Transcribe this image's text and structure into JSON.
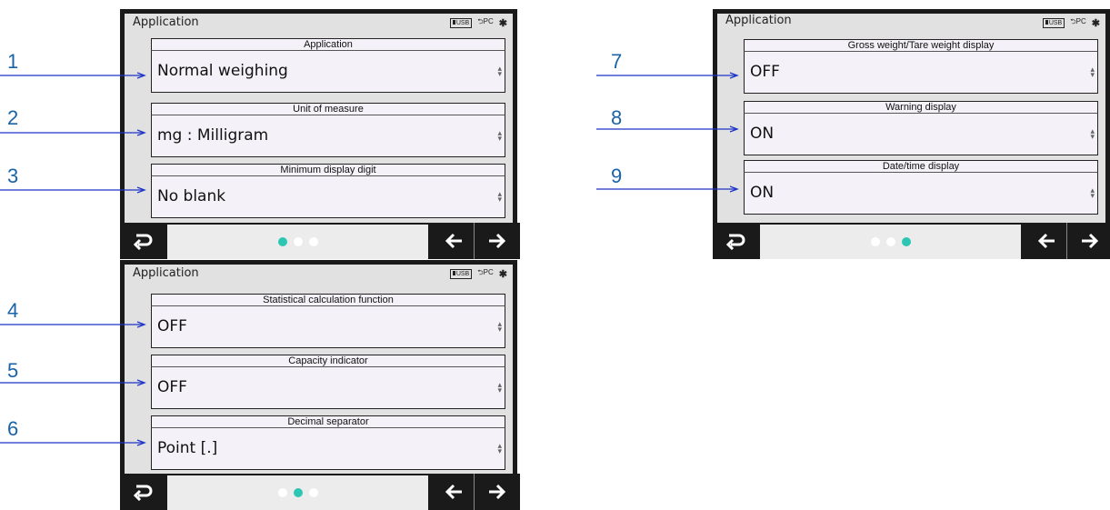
{
  "screens": [
    {
      "title": "Application",
      "status": {
        "usb": "USB",
        "pc": "PC"
      },
      "fields": [
        {
          "label": "Application",
          "value": "Normal weighing"
        },
        {
          "label": "Unit of measure",
          "value": "mg : Milligram"
        },
        {
          "label": "Minimum display digit",
          "value": "No blank"
        }
      ],
      "page_indicator": {
        "active": 1,
        "total": 3
      }
    },
    {
      "title": "Application",
      "status": {
        "usb": "USB",
        "pc": "PC"
      },
      "fields": [
        {
          "label": "Statistical calculation function",
          "value": "OFF"
        },
        {
          "label": "Capacity indicator",
          "value": "OFF"
        },
        {
          "label": "Decimal separator",
          "value": "Point [.]"
        }
      ],
      "page_indicator": {
        "active": 2,
        "total": 3
      }
    },
    {
      "title": "Application",
      "status": {
        "usb": "USB",
        "pc": "PC"
      },
      "fields": [
        {
          "label": "Gross weight/Tare weight display",
          "value": "OFF"
        },
        {
          "label": "Warning display",
          "value": "ON"
        },
        {
          "label": "Date/time display",
          "value": "ON"
        }
      ],
      "page_indicator": {
        "active": 3,
        "total": 3
      }
    }
  ],
  "callouts": [
    "1",
    "2",
    "3",
    "4",
    "5",
    "6",
    "7",
    "8",
    "9"
  ],
  "colors": {
    "accent": "#2dc6b3",
    "callout": "#1a63a8",
    "arrow": "#1f35c8",
    "bar": "#1a1a1a",
    "field_bg": "#f4f2f8"
  },
  "icons": {
    "back": "return-icon",
    "prev": "arrow-left-icon",
    "next": "arrow-right-icon",
    "bluetooth": "bluetooth-icon"
  }
}
